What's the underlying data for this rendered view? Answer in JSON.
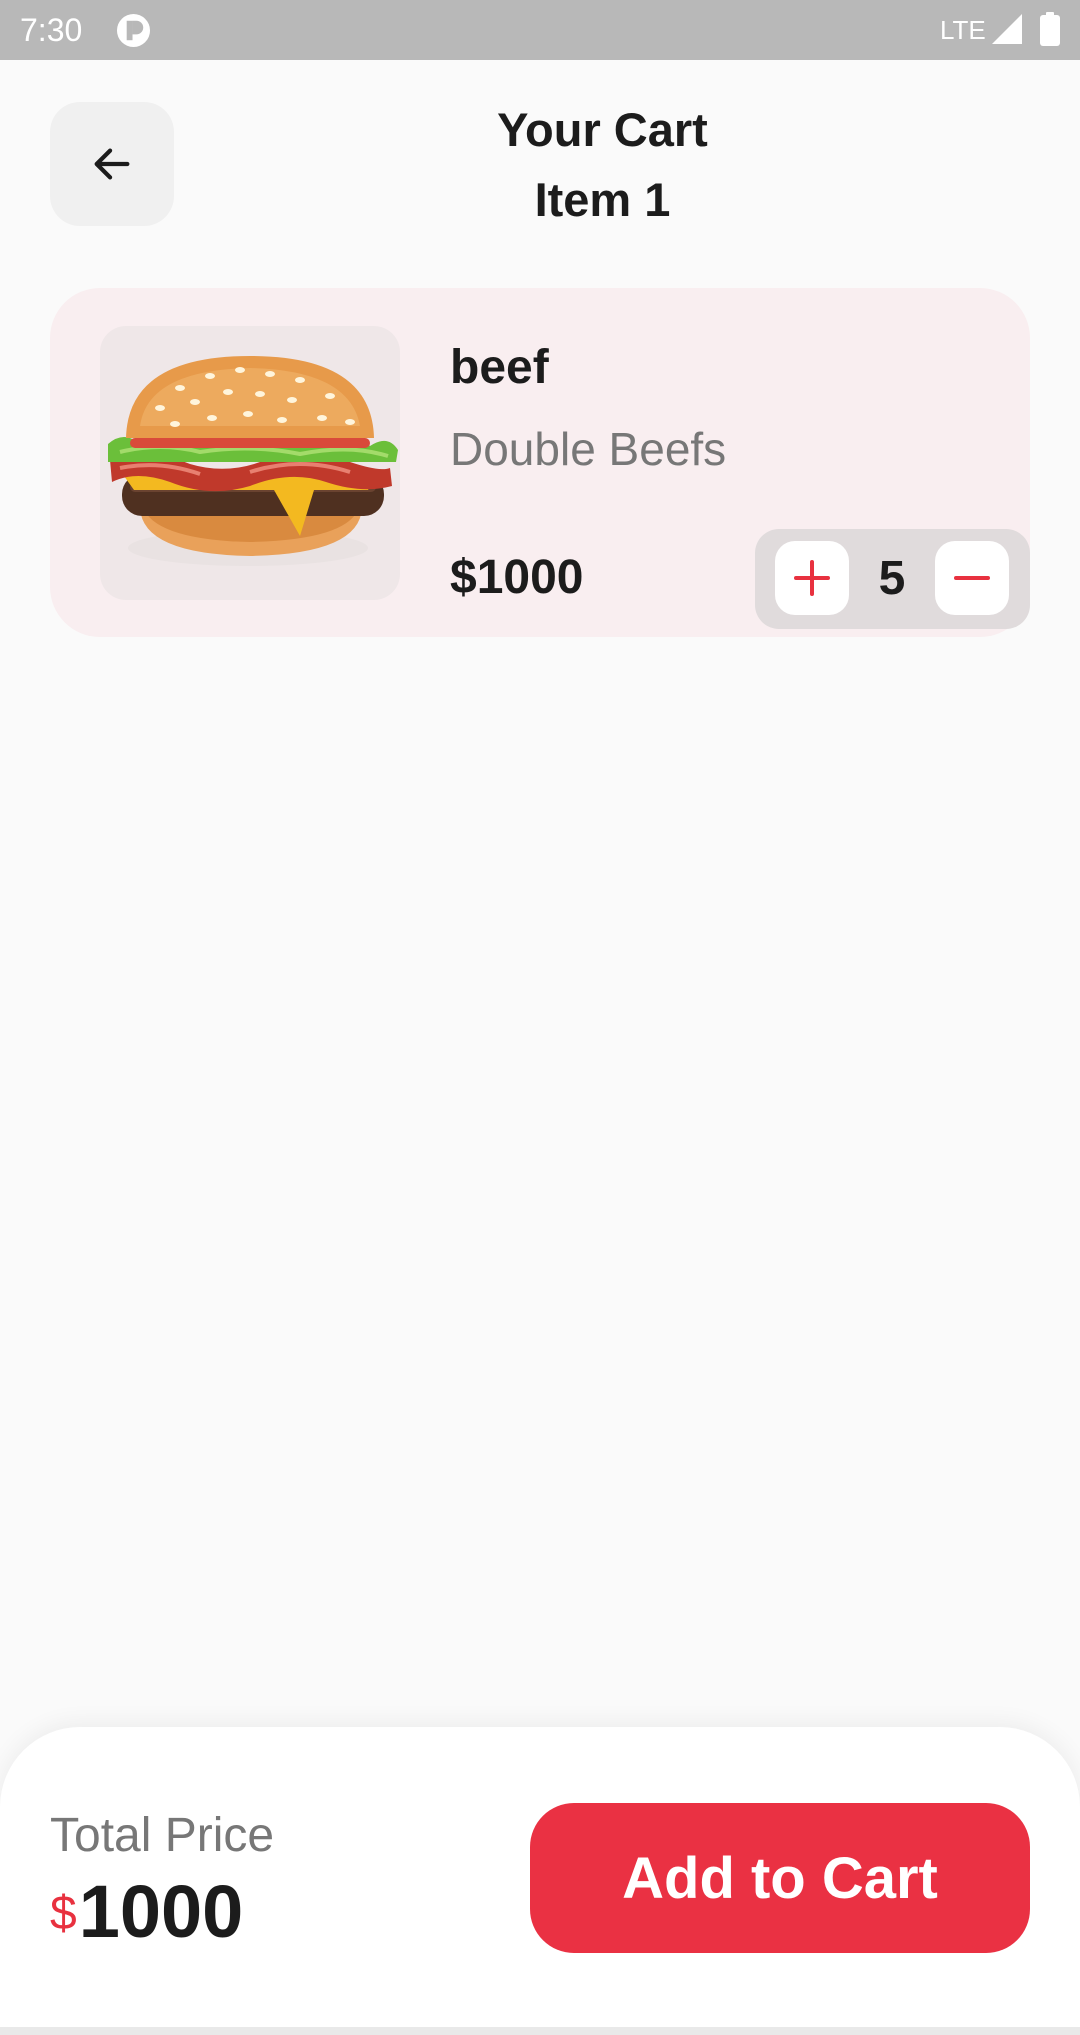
{
  "status_bar": {
    "time": "7:30",
    "network": "LTE"
  },
  "header": {
    "title_line1": "Your Cart",
    "title_line2": "Item 1",
    "back_icon": "arrow-left-icon"
  },
  "cart": {
    "items": [
      {
        "name": "beef",
        "description": "Double Beefs",
        "price": "$1000",
        "quantity": "5",
        "image": "burger-image"
      }
    ]
  },
  "footer": {
    "total_label": "Total Price",
    "currency_symbol": "$",
    "total_amount": "1000",
    "cta_label": "Add to Cart"
  },
  "colors": {
    "accent": "#EA3143",
    "background": "#FAFAFA",
    "card": "#F9EEF0"
  }
}
